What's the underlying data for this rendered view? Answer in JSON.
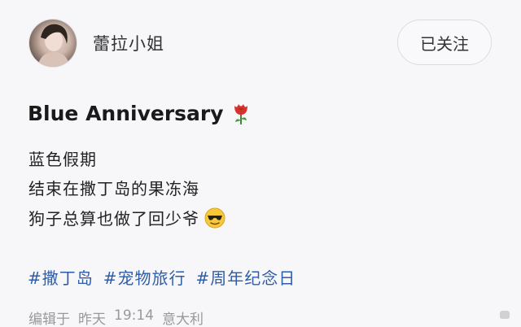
{
  "post": {
    "author": {
      "name": "蕾拉小姐",
      "follow_label": "已关注"
    },
    "title": "Blue Anniversary",
    "title_icon": "rose-icon",
    "lines": [
      "蓝色假期",
      "结束在撒丁岛的果冻海",
      "狗子总算也做了回少爷"
    ],
    "line3_icon": "cool-sunglasses-emoji",
    "tags": [
      "#撒丁岛",
      "#宠物旅行",
      "#周年纪念日"
    ],
    "meta": {
      "prefix": "编辑于",
      "day": "昨天",
      "time": "19:14",
      "location": "意大利"
    },
    "colors": {
      "background": "#f7f7fa",
      "tag": "#2d5da8",
      "meta": "#999999"
    }
  }
}
